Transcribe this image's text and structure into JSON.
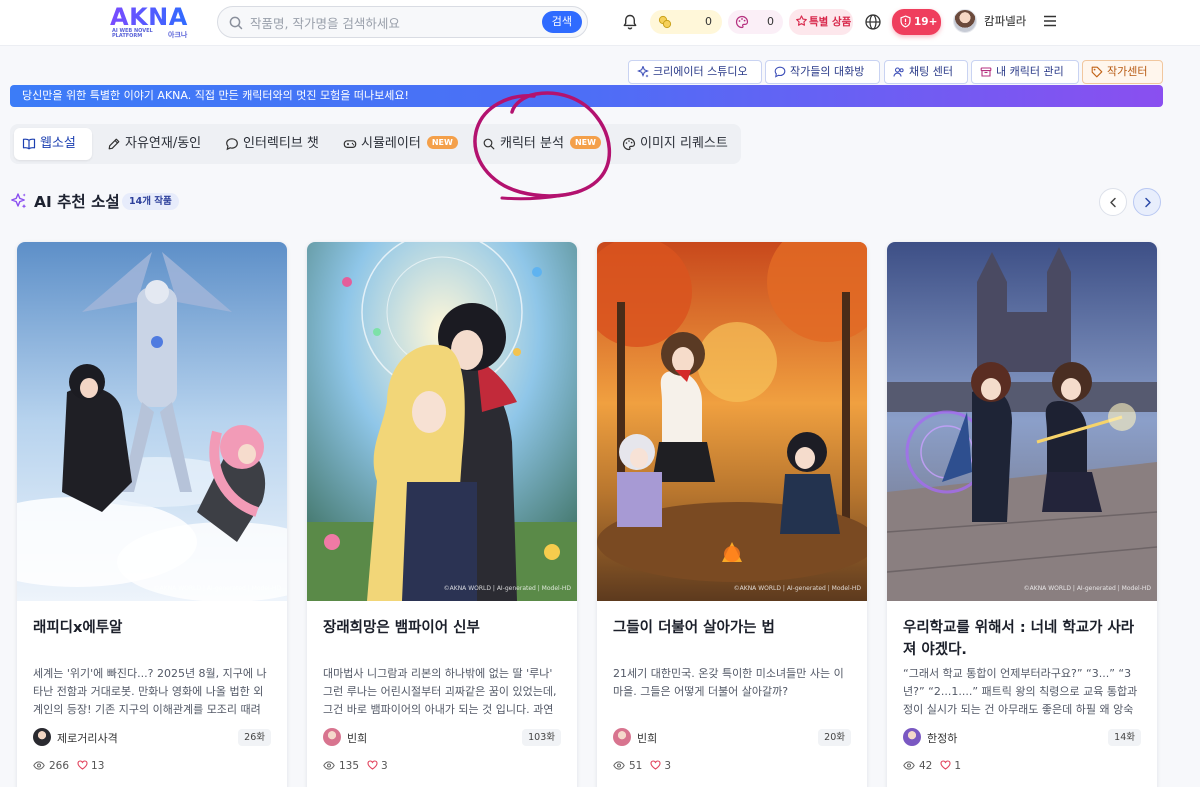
{
  "header": {
    "logo_text": "AKNA",
    "logo_subtitle": "AI WEB NOVEL PLATFORM",
    "logo_korean": "아크나",
    "search_placeholder": "작품명, 작가명을 검색하세요",
    "search_button": "검색",
    "coin_count": "0",
    "gem_count": "0",
    "special_label": "특별 상품",
    "age_label": "19+",
    "user_name": "캄파넬라"
  },
  "quick_buttons": [
    {
      "label": "크리에이터 스튜디오"
    },
    {
      "label": "작가들의 대화방"
    },
    {
      "label": "채팅 센터"
    },
    {
      "label": "내 캐릭터 관리"
    },
    {
      "label": "작가센터"
    }
  ],
  "banner_text": "당신만을 위한 특별한 이야기 AKNA. 직접 만든 캐릭터와의 멋진 모험을 떠나보세요!",
  "tabs": [
    {
      "label": "웹소설",
      "active": true
    },
    {
      "label": "자유연재/동인"
    },
    {
      "label": "인터렉티브 챗"
    },
    {
      "label": "시뮬레이터",
      "badge": "NEW"
    },
    {
      "label": "캐릭터 분석",
      "badge": "NEW"
    },
    {
      "label": "이미지 리퀘스트"
    }
  ],
  "section": {
    "title": "AI 추천 소설",
    "count_badge": "14개 작품"
  },
  "novels": [
    {
      "title": "래피디x에투알",
      "description": "세계는 '위기'에 빠진다...? 2025년 8월, 지구에 나타난 전함과 거대로봇. 만화나 영화에 나올 법한 외계인의 등장! 기존 지구의 이해관계를 모조리 때려 부순 ...",
      "author": "제로거리사격",
      "episodes": "26화",
      "views": "266",
      "likes": "13"
    },
    {
      "title": "장래희망은 뱀파이어 신부",
      "description": "대마법사 니그람과 리본의 하나밖에 없는 딸 '루나' 그런 루나는 어린시절부터 괴짜같은 꿈이 있었는데, 그건 바로 뱀파이어의 아내가 되는 것 입니다. 과연 루...",
      "author": "빈희",
      "episodes": "103화",
      "views": "135",
      "likes": "3"
    },
    {
      "title": "그들이 더불어 살아가는 법",
      "description": "21세기 대한민국. 온갖 특이한 미소녀들만 사는 이 마을. 그들은 어떻게 더불어 살아갈까?",
      "author": "빈희",
      "episodes": "20화",
      "views": "51",
      "likes": "3"
    },
    {
      "title": "우리학교를 위해서 : 너네 학교가 사라져 야겠다.",
      "description": "“그래서 학교 통합이 언제부터라구요?” “3...” “3년?” “2...1....” 패트릭 왕의 칙령으로 교육 통합과정이 실시가 되는 건 아무래도 좋은데 하필 왜 앙숙인 기...",
      "author": "한정하",
      "episodes": "14화",
      "views": "42",
      "likes": "1"
    }
  ],
  "cover_watermark": "©AKNA WORLD | AI-generated | Model-HD",
  "colors": {
    "accent": "#2f6bff",
    "banner_start": "#3c7cf7",
    "banner_end": "#8a4ff0",
    "new_badge": "#f4a04a",
    "age_badge": "#ef3e5d",
    "annotation": "#b3126f"
  },
  "icons": {
    "search": "search-icon",
    "bell": "bell-icon",
    "coin": "coin-icon",
    "gem": "palette-icon",
    "special": "gift-icon",
    "globe": "globe-icon",
    "shield": "shield-icon",
    "menu": "hamburger-menu-icon",
    "sparkle": "sparkle-icon",
    "prev": "chevron-left-icon",
    "next": "chevron-right-icon",
    "views": "eye-icon",
    "likes": "heart-icon"
  }
}
